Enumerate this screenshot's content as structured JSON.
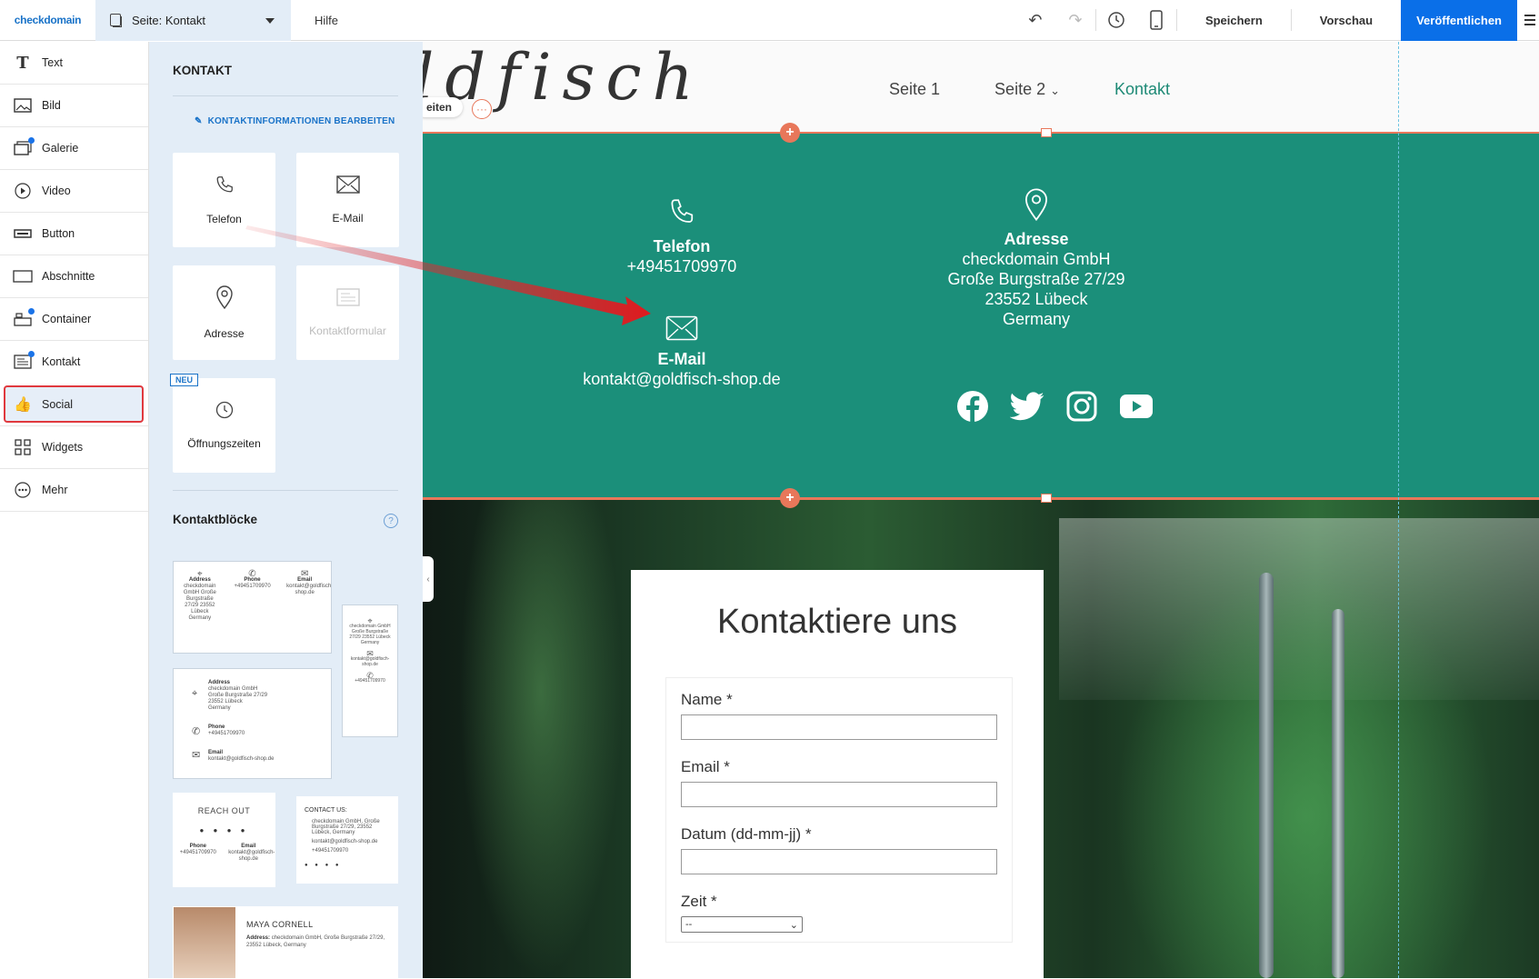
{
  "topbar": {
    "logo": "checkdomain",
    "page_prefix": "Seite:",
    "page_name": "Kontakt",
    "help": "Hilfe",
    "save": "Speichern",
    "preview": "Vorschau",
    "publish": "Veröffentlichen"
  },
  "sidebar": {
    "items": [
      {
        "label": "Text",
        "icon": "text-icon"
      },
      {
        "label": "Bild",
        "icon": "image-icon"
      },
      {
        "label": "Galerie",
        "icon": "gallery-icon"
      },
      {
        "label": "Video",
        "icon": "play-icon"
      },
      {
        "label": "Button",
        "icon": "button-icon"
      },
      {
        "label": "Abschnitte",
        "icon": "section-icon"
      },
      {
        "label": "Container",
        "icon": "container-icon"
      },
      {
        "label": "Kontakt",
        "icon": "contact-icon"
      },
      {
        "label": "Social",
        "icon": "thumbs-up-icon"
      },
      {
        "label": "Widgets",
        "icon": "widgets-icon"
      },
      {
        "label": "Mehr",
        "icon": "more-icon"
      }
    ]
  },
  "panel": {
    "title": "KONTAKT",
    "edit_link": "KONTAKTINFORMATIONEN BEARBEITEN",
    "tiles": {
      "phone": "Telefon",
      "email": "E-Mail",
      "address": "Adresse",
      "form": "Kontaktformular",
      "hours": "Öffnungszeiten"
    },
    "new_badge": "NEU",
    "blocks_title": "Kontaktblöcke",
    "help": "?",
    "block1": {
      "address_h": "Address",
      "address": "checkdomain GmbH Große Burgstraße 27/29 23552 Lübeck Germany",
      "phone_h": "Phone",
      "phone": "+49451709970",
      "email_h": "Email",
      "email": "kontakt@goldfisch-shop.de"
    },
    "block2": {
      "address_h": "Address",
      "address1": "checkdomain GmbH",
      "address2": "Große Burgstraße 27/29",
      "address3": "23552 Lübeck",
      "address4": "Germany",
      "phone_h": "Phone",
      "phone": "+49451709970",
      "email_h": "Email",
      "email": "kontakt@goldfisch-shop.de"
    },
    "block3": {
      "address": "checkdomain GmbH Große Burgstraße 27/29 23552 Lübeck Germany",
      "email": "kontakt@goldfisch-shop.de",
      "phone": "+49451709970"
    },
    "block4": {
      "title": "REACH OUT",
      "phone_h": "Phone",
      "phone": "+49451709970",
      "email_h": "Email",
      "email": "kontakt@goldfisch-shop.de"
    },
    "block5": {
      "title": "CONTACT US:",
      "address": "checkdomain GmbH, Große Burgstraße 27/29, 23552 Lübeck, Germany",
      "email": "kontakt@goldfisch-shop.de",
      "phone": "+49451709970"
    },
    "block6": {
      "name": "MAYA CORNELL",
      "address_h": "Address:",
      "address": "checkdomain GmbH, Große Burgstraße 27/29, 23552 Lübeck, Germany"
    }
  },
  "site": {
    "brand": "ldfisch",
    "pill": "eiten",
    "more": "···",
    "nav": [
      "Seite 1",
      "Seite 2",
      "Kontakt"
    ],
    "contact": {
      "phone_title": "Telefon",
      "phone": "+49451709970",
      "email_title": "E-Mail",
      "email": "kontakt@goldfisch-shop.de",
      "address_title": "Adresse",
      "address_lines": [
        "checkdomain GmbH",
        "Große Burgstraße 27/29",
        "23552 Lübeck",
        "Germany"
      ]
    },
    "social": [
      "facebook-icon",
      "twitter-icon",
      "instagram-icon",
      "youtube-icon"
    ],
    "form": {
      "title": "Kontaktiere uns",
      "name_label": "Name *",
      "email_label": "Email *",
      "date_label": "Datum (dd-mm-jj) *",
      "time_label": "Zeit *",
      "time_value": "--"
    }
  },
  "colors": {
    "accent": "#0a6fe8",
    "green": "#1b8f7a",
    "orange": "#e8775a",
    "panel": "#e3edf7",
    "highlight": "#e0393e"
  }
}
